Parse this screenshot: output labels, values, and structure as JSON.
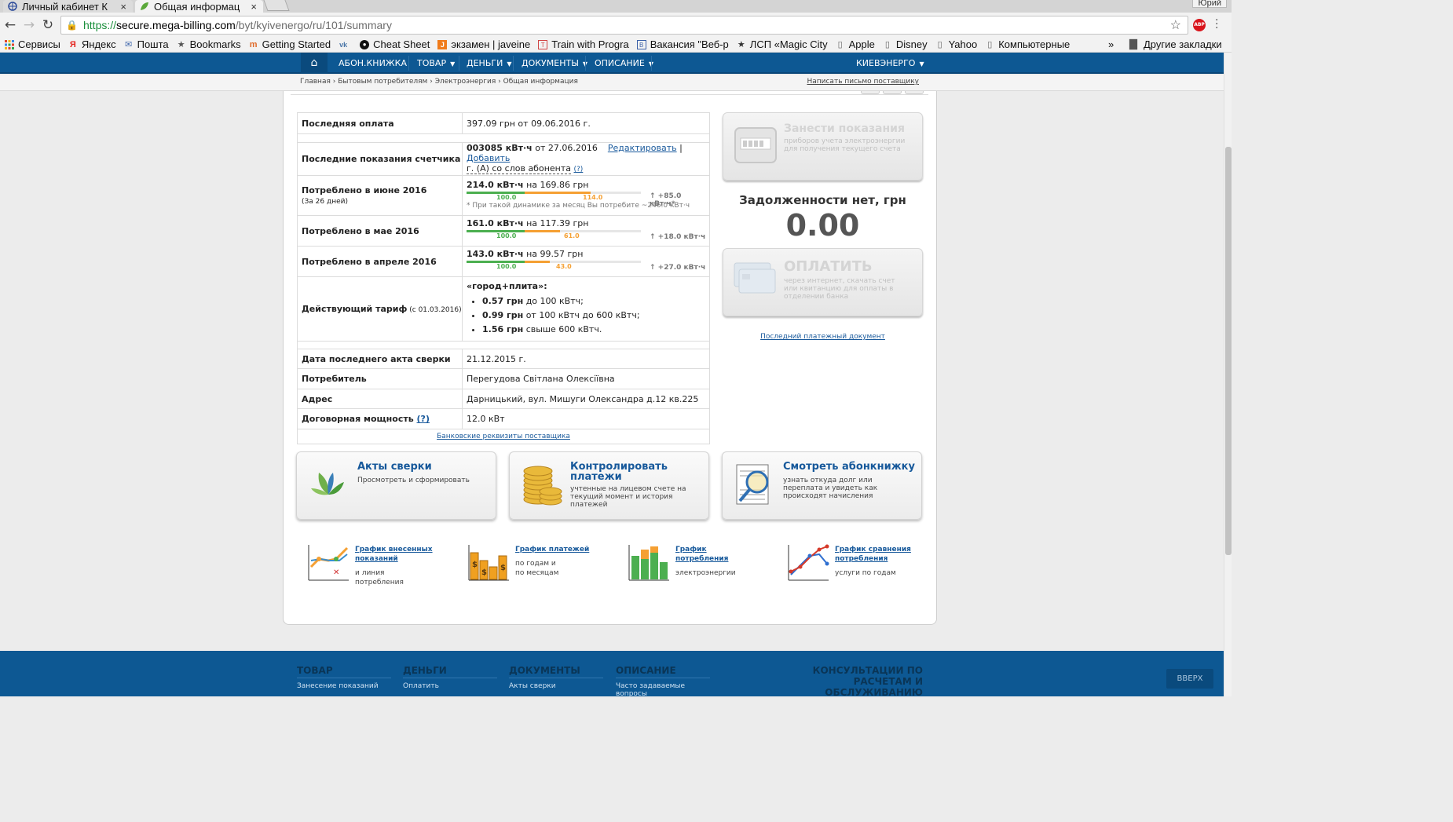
{
  "browser": {
    "tabs": [
      {
        "title": "Личный кабинет К",
        "active": false,
        "close": "×"
      },
      {
        "title": "Общая информац",
        "active": true,
        "close": "×"
      }
    ],
    "user": "Юрий",
    "url": {
      "scheme": "https://",
      "host": "secure.mega-billing.com",
      "path": "/byt/kyivenergo/ru/101/summary"
    },
    "bookmarks": [
      {
        "label": "Сервисы",
        "icon": "apps-grid-icon"
      },
      {
        "label": "Яндекс",
        "icon": "yandex-icon"
      },
      {
        "label": "Пошта",
        "icon": "mail-icon"
      },
      {
        "label": "Bookmarks",
        "icon": "star-icon"
      },
      {
        "label": "Getting Started",
        "icon": "firefox-icon"
      },
      {
        "label": "",
        "icon": "vk-icon"
      },
      {
        "label": "Cheat Sheet",
        "icon": "github-icon"
      },
      {
        "label": "экзамен | javeine",
        "icon": "javeine-icon"
      },
      {
        "label": "Train with Progra",
        "icon": "train-icon"
      },
      {
        "label": "Вакансия \"Веб-р",
        "icon": "vacancy-icon"
      },
      {
        "label": "ЛСП «Magic City",
        "icon": "star-icon"
      },
      {
        "label": "Apple",
        "icon": "page-icon"
      },
      {
        "label": "Disney",
        "icon": "page-icon"
      },
      {
        "label": "Yahoo",
        "icon": "page-icon"
      },
      {
        "label": "Компьютерные",
        "icon": "page-icon"
      }
    ],
    "bookmarks_more": "»",
    "other_bookmarks": "Другие закладки"
  },
  "sitenav": {
    "items": [
      {
        "label": "АБОН.КНИЖКА",
        "dropdown": false
      },
      {
        "label": "ТОВАР",
        "dropdown": true
      },
      {
        "label": "ДЕНЬГИ",
        "dropdown": true
      },
      {
        "label": "ДОКУМЕНТЫ",
        "dropdown": true
      },
      {
        "label": "ОПИСАНИЕ",
        "dropdown": true
      }
    ],
    "provider": "КИЕВЭНЕРГО"
  },
  "breadcrumbs": [
    "Главная",
    "Бытовым потребителям",
    "Электроэнергия",
    "Общая информация"
  ],
  "breadcrumb_sep": "›",
  "write_letter": "Написать письмо поставщику",
  "info": {
    "last_payment": {
      "label": "Последняя оплата",
      "value": "397.09 грн от 09.06.2016 г."
    },
    "last_reading": {
      "label": "Последние показания счетчика",
      "value_bold": "003085 кВт·ч",
      "value_rest": " от 27.06.2016",
      "edit": "Редактировать",
      "sep": "|",
      "add": "Добавить",
      "line2": "г. (А) со слов абонента",
      "help": "(?)"
    },
    "consumption": [
      {
        "label": "Потреблено в июне 2016",
        "sub": "(За 26 дней)",
        "kwh": "214.0 кВт·ч",
        "sum": " на 169.86 грн",
        "green": 100.0,
        "orange": 114.0,
        "green_label": "100.0",
        "orange_label": "114.0",
        "delta": "↑ +85.0 кВт·ч*",
        "note": "* При такой динамике за месяц Вы потребите ~246.0 кВт·ч"
      },
      {
        "label": "Потреблено в мае 2016",
        "sub": "",
        "kwh": "161.0 кВт·ч",
        "sum": " на 117.39 грн",
        "green": 100.0,
        "orange": 61.0,
        "green_label": "100.0",
        "orange_label": "61.0",
        "delta": "↑ +18.0 кВт·ч",
        "note": ""
      },
      {
        "label": "Потреблено в апреле 2016",
        "sub": "",
        "kwh": "143.0 кВт·ч",
        "sum": " на 99.57 грн",
        "green": 100.0,
        "orange": 43.0,
        "green_label": "100.0",
        "orange_label": "43.0",
        "delta": "↑ +27.0 кВт·ч",
        "note": ""
      }
    ],
    "tariff": {
      "label": "Действующий тариф",
      "since": " (с 01.03.2016)",
      "name": "«город+плита»:",
      "rates": [
        {
          "price": "0.57 грн",
          "desc": " до 100 кВтч;"
        },
        {
          "price": "0.99 грн",
          "desc": " от 100 кВтч до 600 кВтч;"
        },
        {
          "price": "1.56 грн",
          "desc": " свыше 600 кВтч."
        }
      ]
    },
    "act_date": {
      "label": "Дата последнего акта сверки",
      "value": "21.12.2015 г."
    },
    "consumer": {
      "label": "Потребитель",
      "value": "Перегудова Світлана Олексіївна"
    },
    "address": {
      "label": "Адрес",
      "value": "Дарницький, вул. Мишуги Олександра д.12 кв.225"
    },
    "power": {
      "label": "Договорная мощность",
      "help": "(?)",
      "value": "12.0 кВт"
    },
    "bank_link": "Банковские реквизиты поставщика"
  },
  "right": {
    "enter_readings": {
      "title": "Занести показания",
      "desc": "приборов учета электроэнергии для получения текущего счета"
    },
    "debt_label": "Задолженности нет, грн",
    "debt_value": "0.00",
    "pay": {
      "title": "ОПЛАТИТЬ",
      "desc": "через интернет, скачать счет или квитанцию для оплаты в отделении банка"
    },
    "last_doc": "Последний платежный документ"
  },
  "tiles": [
    {
      "title": "Акты сверки",
      "desc": "Просмотреть и сформировать",
      "icon": "leaf-icon"
    },
    {
      "title": "Контролировать платежи",
      "desc": "учтенные на лицевом счете на текущий момент и история платежей",
      "icon": "coins-icon"
    },
    {
      "title": "Смотреть абонкнижку",
      "desc": "узнать откуда долг или переплата и увидеть как происходят начисления",
      "icon": "magnifier-document-icon"
    }
  ],
  "graph_links": [
    {
      "title": "График внесенных показаний",
      "desc": "и линия потребления",
      "icon": "readings-chart-icon"
    },
    {
      "title": "График платежей",
      "desc": "по годам и по месяцам",
      "icon": "payments-chart-icon"
    },
    {
      "title": "График потребления",
      "desc": "электроэнергии",
      "icon": "consumption-chart-icon"
    },
    {
      "title": "График сравнения потребления",
      "desc": "услуги по годам",
      "icon": "comparison-chart-icon"
    }
  ],
  "footer": {
    "columns": [
      {
        "title": "ТОВАР",
        "link": "Занесение показаний"
      },
      {
        "title": "ДЕНЬГИ",
        "link": "Оплатить"
      },
      {
        "title": "ДОКУМЕНТЫ",
        "link": "Акты сверки"
      },
      {
        "title": "ОПИСАНИЕ",
        "link": "Часто задаваемые вопросы"
      }
    ],
    "consult": "КОНСУЛЬТАЦИИ ПО РАСЧЕТАМ И ОБСЛУЖИВАНИЮ",
    "up": "ВВЕРХ"
  },
  "colors": {
    "nav": "#0d5893",
    "green": "#4caf50",
    "orange": "#f5a033",
    "link": "#17599b"
  }
}
